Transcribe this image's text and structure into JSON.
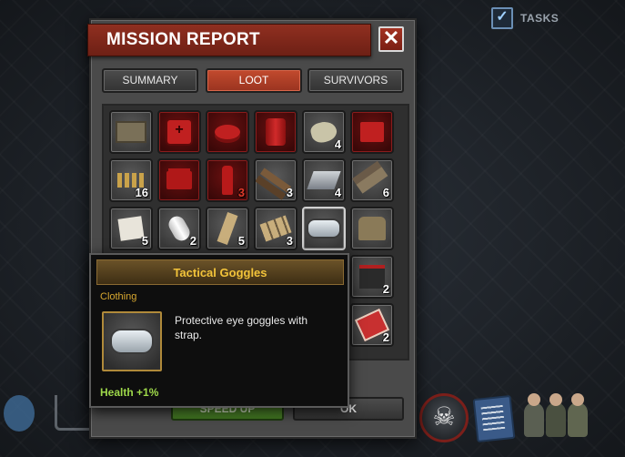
{
  "tasks": {
    "label": "TASKS",
    "checked": true
  },
  "window": {
    "title": "MISSION REPORT",
    "close_label": "✕"
  },
  "tabs": [
    {
      "label": "SUMMARY",
      "active": false
    },
    {
      "label": "LOOT",
      "active": true
    },
    {
      "label": "SURVIVORS",
      "active": false
    }
  ],
  "loot": {
    "rows": [
      [
        {
          "icon": "ammo-crate-icon",
          "qty": "",
          "rare": false
        },
        {
          "icon": "first-aid-bag-icon",
          "qty": "",
          "rare": true
        },
        {
          "icon": "food-can-icon",
          "qty": "",
          "rare": true
        },
        {
          "icon": "fuel-barrel-icon",
          "qty": "",
          "rare": true
        },
        {
          "icon": "cloth-rag-icon",
          "qty": "4",
          "rare": false
        },
        {
          "icon": "red-box-icon",
          "qty": "",
          "rare": true
        }
      ],
      [
        {
          "icon": "bullets-icon",
          "qty": "16",
          "rare": false
        },
        {
          "icon": "toy-brick-icon",
          "qty": "",
          "rare": true
        },
        {
          "icon": "bottle-icon",
          "qty": "3",
          "rare": true
        },
        {
          "icon": "wood-plank-icon",
          "qty": "3",
          "rare": false
        },
        {
          "icon": "steel-beam-icon",
          "qty": "4",
          "rare": false
        },
        {
          "icon": "timber-icon",
          "qty": "6",
          "rare": false
        }
      ],
      [
        {
          "icon": "paper-icon",
          "qty": "5",
          "rare": false
        },
        {
          "icon": "paper-roll-icon",
          "qty": "2",
          "rare": false
        },
        {
          "icon": "wood-stick-icon",
          "qty": "5",
          "rare": false
        },
        {
          "icon": "wood-sticks-icon",
          "qty": "3",
          "rare": false
        },
        {
          "icon": "goggles-icon",
          "qty": "",
          "rare": false,
          "selected": true
        },
        {
          "icon": "boots-icon",
          "qty": "",
          "rare": false
        }
      ]
    ],
    "extra": [
      {
        "icon": "battery-icon",
        "qty": "2"
      },
      {
        "icon": "matches-icon",
        "qty": "2"
      }
    ]
  },
  "buttons": {
    "speed_up": "SPEED UP",
    "ok": "OK"
  },
  "tooltip": {
    "title": "Tactical Goggles",
    "category": "Clothing",
    "description": "Protective eye goggles with strap.",
    "stat": "Health +1%"
  }
}
